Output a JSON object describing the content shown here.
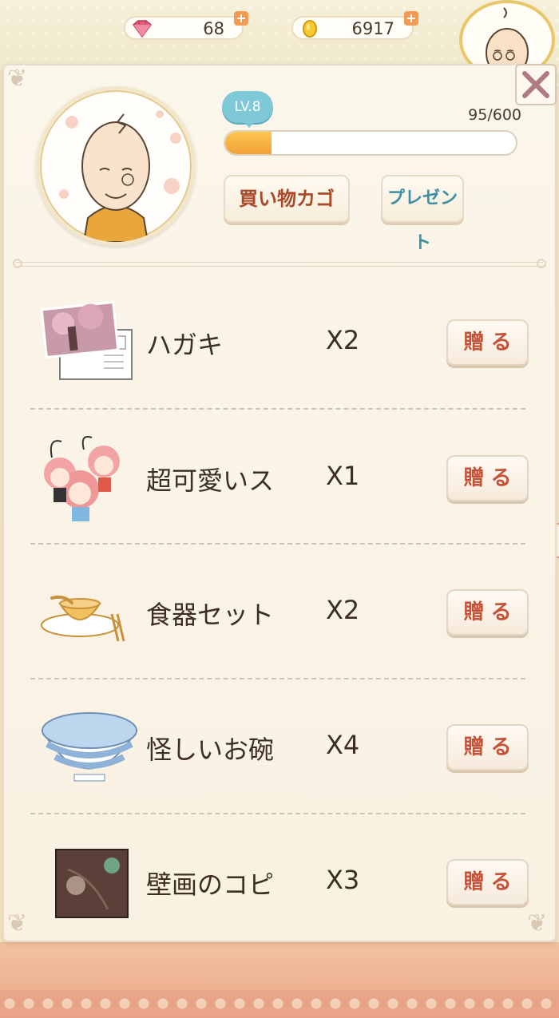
{
  "currency": {
    "gems": "68",
    "coins": "6917",
    "plus_symbol": "+"
  },
  "character": {
    "level": "LV.8",
    "exp_text": "95/600",
    "exp_fraction": 0.158
  },
  "buttons": {
    "cart": "買い物カゴ",
    "present": "プレゼント",
    "close": "✕"
  },
  "items": [
    {
      "name": "ハガキ",
      "count": "X2",
      "action": "贈る"
    },
    {
      "name": "超可愛いス",
      "count": "X1",
      "action": "贈る"
    },
    {
      "name": "食器セット",
      "count": "X2",
      "action": "贈る"
    },
    {
      "name": "怪しいお碗",
      "count": "X4",
      "action": "贈る"
    },
    {
      "name": "壁画のコピ",
      "count": "X3",
      "action": "贈る"
    }
  ],
  "colors": {
    "accent_red": "#c4533a",
    "accent_teal": "#3d8fa3",
    "exp_orange": "#f2a23a",
    "level_blue": "#7fc8d8"
  }
}
